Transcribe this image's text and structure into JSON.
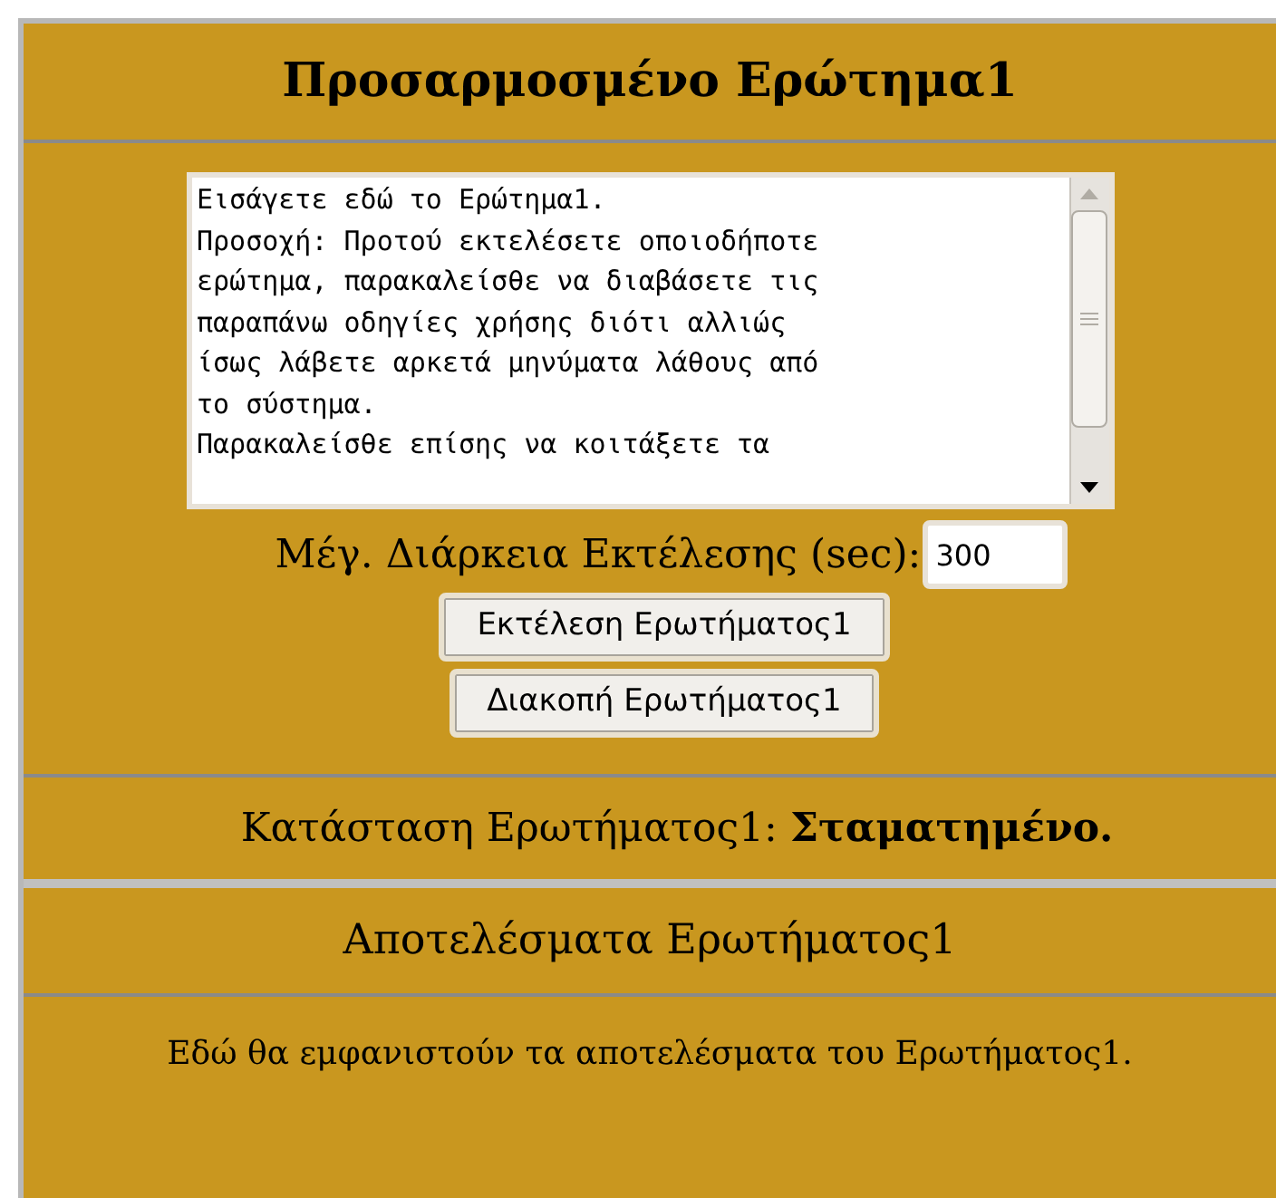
{
  "title": "Προσαρμοσμένο Ερώτημα1",
  "query_box": {
    "lines": [
      "Εισάγετε εδώ το Ερώτημα1.",
      "Προσοχή: Προτού εκτελέσετε οποιοδήποτε",
      "ερώτημα, παρακαλείσθε να διαβάσετε τις",
      "παραπάνω οδηγίες χρήσης διότι αλλιώς",
      "ίσως λάβετε αρκετά μηνύματα λάθους από",
      "το σύστημα.",
      "Παρακαλείσθε επίσης να κοιτάξετε τα"
    ]
  },
  "max_duration": {
    "label": "Μέγ. Διάρκεια Εκτέλεσης (sec):",
    "value": "300"
  },
  "buttons": [
    "Εκτέλεση Ερωτήματος1",
    "Διακοπή Ερωτήματος1"
  ],
  "status": "Κατάσταση Ερωτήματος1: **Σταματημένο.**",
  "results": {
    "title": "Αποτελέσματα Ερωτήματος1",
    "text": "Εδώ θα εμφανιστούν τα αποτελέσματα του Ερωτήματος1."
  }
}
